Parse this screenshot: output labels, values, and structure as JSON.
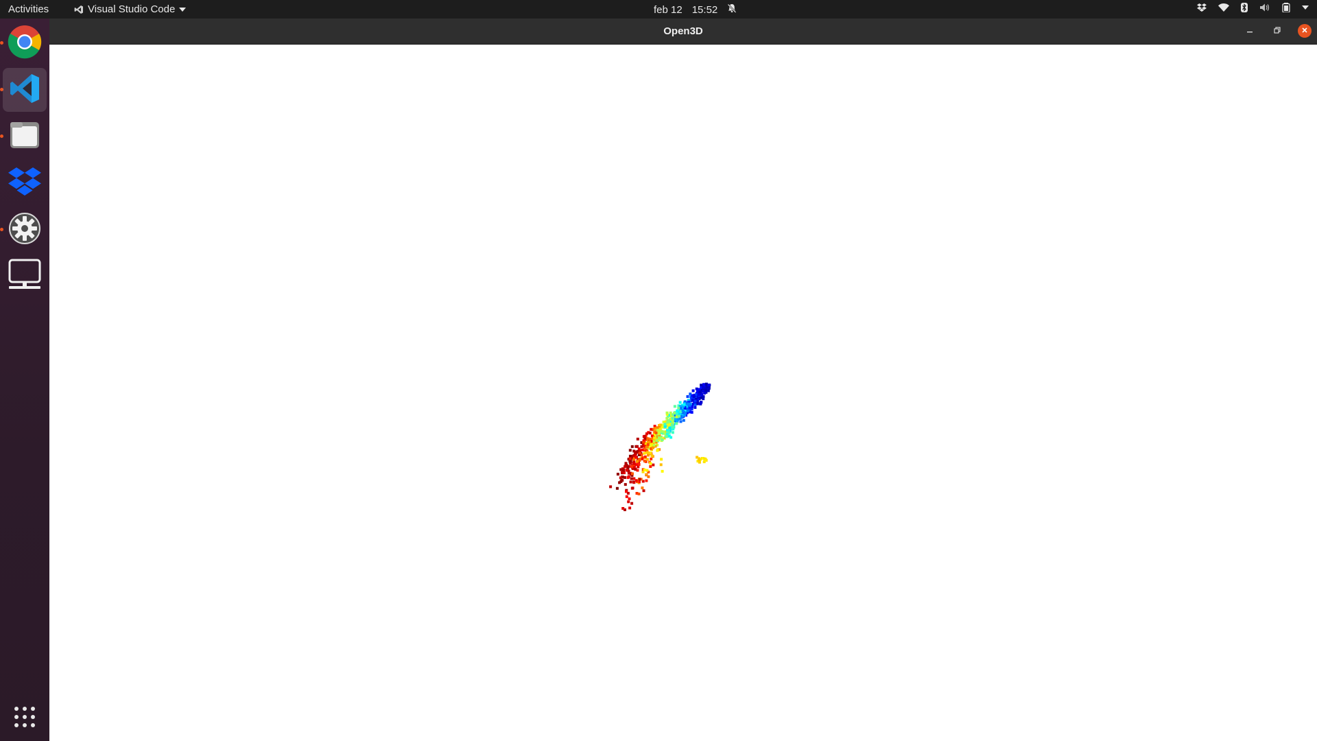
{
  "topbar": {
    "activities": "Activities",
    "app_menu_label": "Visual Studio Code",
    "date": "feb 12",
    "time": "15:52",
    "tray_icons": [
      "dropbox-icon",
      "wifi-icon",
      "bluetooth-icon",
      "volume-icon",
      "battery-icon",
      "system-menu-chevron-icon"
    ]
  },
  "dock": {
    "items": [
      {
        "name": "chrome",
        "icon": "chrome-icon",
        "running": true,
        "active": false
      },
      {
        "name": "vscode",
        "icon": "vscode-icon",
        "running": true,
        "active": true
      },
      {
        "name": "files",
        "icon": "files-icon",
        "running": true,
        "active": false
      },
      {
        "name": "dropbox",
        "icon": "dropbox-icon",
        "running": false,
        "active": false
      },
      {
        "name": "settings",
        "icon": "settings-gear-icon",
        "running": true,
        "active": false
      },
      {
        "name": "display",
        "icon": "monitor-icon",
        "running": false,
        "active": false
      }
    ],
    "show_apps_icon": "app-grid-icon"
  },
  "window": {
    "title": "Open3D",
    "controls": [
      "minimize",
      "restore",
      "close"
    ],
    "accent_close": "#e95420"
  },
  "viewer": {
    "background": "#ffffff",
    "point_cloud_colormap": "jet",
    "colormap_stops": [
      "#00007f",
      "#0000ff",
      "#00ffff",
      "#ffff00",
      "#ff0000",
      "#7f0000"
    ]
  },
  "colors": {
    "topbar": "#1d1d1d",
    "dock": "#2d1b2a",
    "titlebar": "#2f2f2f",
    "running_indicator": "#e95420"
  }
}
